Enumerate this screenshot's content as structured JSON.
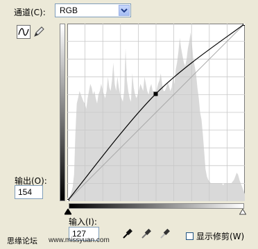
{
  "channel": {
    "label": "通道(C):",
    "value": "RGB",
    "dropdown_icon": "chevron-down-icon"
  },
  "tools": {
    "curve_icon": "curve-tool-icon",
    "pencil_icon": "pencil-icon"
  },
  "output": {
    "label": "输出(O):",
    "value": "154"
  },
  "input": {
    "label": "输入(I):",
    "value": "127"
  },
  "eyedroppers": [
    "black-eyedropper-icon",
    "gray-eyedropper-icon",
    "white-eyedropper-icon"
  ],
  "show_clipping": {
    "label": "显示修剪(W)",
    "checked": false
  },
  "watermark": {
    "forum": "思缘论坛",
    "url": "www.missyuan.com"
  },
  "curve": {
    "points": [
      [
        0,
        0
      ],
      [
        127,
        154
      ],
      [
        255,
        255
      ]
    ],
    "histogram_levels": [
      0.02,
      0.02,
      0.03,
      0.05,
      0.08,
      0.15,
      0.38,
      0.55,
      0.58,
      0.62,
      0.6,
      0.58,
      0.56,
      0.55,
      0.52,
      0.58,
      0.62,
      0.66,
      0.64,
      0.6,
      0.62,
      0.58,
      0.55,
      0.6,
      0.62,
      0.66,
      0.63,
      0.6,
      0.58,
      0.62,
      0.7,
      0.64,
      0.62,
      0.68,
      0.78,
      0.66,
      0.62,
      0.7,
      0.64,
      0.6,
      0.58,
      0.56,
      0.62,
      0.86,
      0.68,
      0.62,
      0.58,
      0.56,
      0.72,
      0.64,
      0.6,
      0.58,
      0.6,
      0.63,
      0.66,
      0.64,
      0.62,
      0.7,
      0.66,
      0.62,
      0.6,
      0.64,
      0.66,
      0.62,
      0.62,
      0.6,
      0.63,
      0.66,
      0.68,
      0.72,
      0.66,
      0.62,
      0.62,
      0.64,
      0.67,
      0.65,
      0.62,
      0.64,
      0.7,
      0.66,
      0.74,
      0.78,
      0.84,
      0.92,
      0.86,
      0.82,
      0.78,
      0.76,
      0.8,
      0.86,
      0.9,
      0.95,
      0.88,
      0.8,
      0.76,
      0.72,
      0.64,
      0.58,
      0.5,
      0.46,
      0.38,
      0.28,
      0.18,
      0.14,
      0.12,
      0.11,
      0.1,
      0.1,
      0.1,
      0.1,
      0.1,
      0.1,
      0.1,
      0.1,
      0.1,
      0.09,
      0.1,
      0.1,
      0.1,
      0.1,
      0.1,
      0.1,
      0.11,
      0.12,
      0.14,
      0.16,
      0.15,
      0.12,
      0.1,
      0.08,
      0.06,
      0.04
    ]
  }
}
